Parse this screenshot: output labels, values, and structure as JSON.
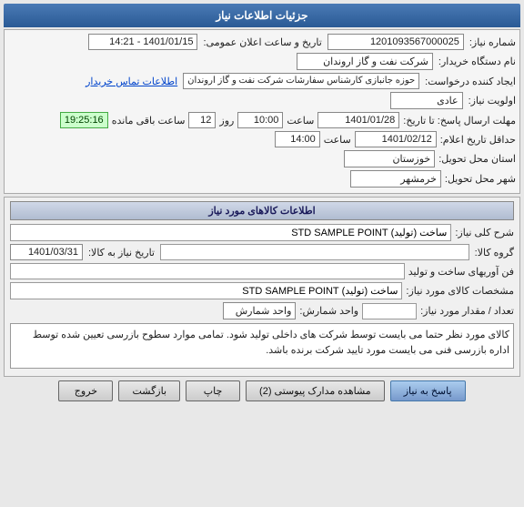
{
  "header": {
    "title": "جزئیات اطلاعات نیاز"
  },
  "top_section": {
    "notice_number_label": "شماره نیاز:",
    "notice_number_value": "1201093567000025",
    "date_label": "تاریخ و ساعت اعلان عمومی:",
    "date_value": "1401/01/15 - 14:21"
  },
  "requester_section": {
    "name_label": "نام دستگاه خریدار:",
    "name_value": "شرکت نفت و گاز اروندان",
    "request_label": "ایجاد کننده درخواست:",
    "request_value": "حوزه جانبازی کارشناس سفارشات شرکت نفت و گاز اروندان",
    "contact_link": "اطلاعات تماس خریدار"
  },
  "priority_section": {
    "priority_label": "اولویت نیاز:",
    "priority_value": "عادی"
  },
  "send_date_section": {
    "label": "مهلت ارسال پاسخ: تا تاریخ:",
    "date_value": "1401/01/28",
    "time_label": "ساعت",
    "time_value": "10:00",
    "day_label": "روز",
    "day_value": "12",
    "remaining_label": "ساعت باقی مانده",
    "remaining_value": "19:25:16"
  },
  "action_date_section": {
    "label": "حداقل تاریخ اعلام:",
    "date_value": "1401/02/12",
    "time_label": "ساعت",
    "time_value": "14:00"
  },
  "province_section": {
    "label": "استان محل تحویل:",
    "value": "خوزستان"
  },
  "city_section": {
    "label": "شهر محل تحویل:",
    "value": "خرمشهر"
  },
  "goods_section": {
    "title": "اطلاعات کالاهای مورد نیاز",
    "description_label": "شرح کلی نیاز:",
    "description_value": "ساخت (تولید) STD SAMPLE POINT",
    "group_label": "گروه کالا:",
    "group_date_label": "تاریخ نیاز به کالا:",
    "group_date_value": "1401/03/31",
    "mfg_label": "فن آوریهای ساخت و تولید",
    "spec_label": "مشخصات کالای مورد نیاز:",
    "spec_value": "ساخت (تولید) STD SAMPLE POINT",
    "qty_label": "تعداد / مقدار مورد نیاز:",
    "qty_value": "",
    "unit_label": "واحد شمارش:",
    "unit_value": "واحد شمارش"
  },
  "description_text": "کالای مورد نظر حتما می بایست توسط شرکت های داخلی تولید شود. تمامی موارد سطوح بازرسی تعیین شده توسط اداره بازرسی فنی می بایست مورد تایید شرکت برنده باشد.",
  "buttons": {
    "answer": "پاسخ به نیاز",
    "observe": "مشاهده مدارک پیوستی (2)",
    "print": "چاپ",
    "return": "بازگشت",
    "exit": "خروج"
  }
}
